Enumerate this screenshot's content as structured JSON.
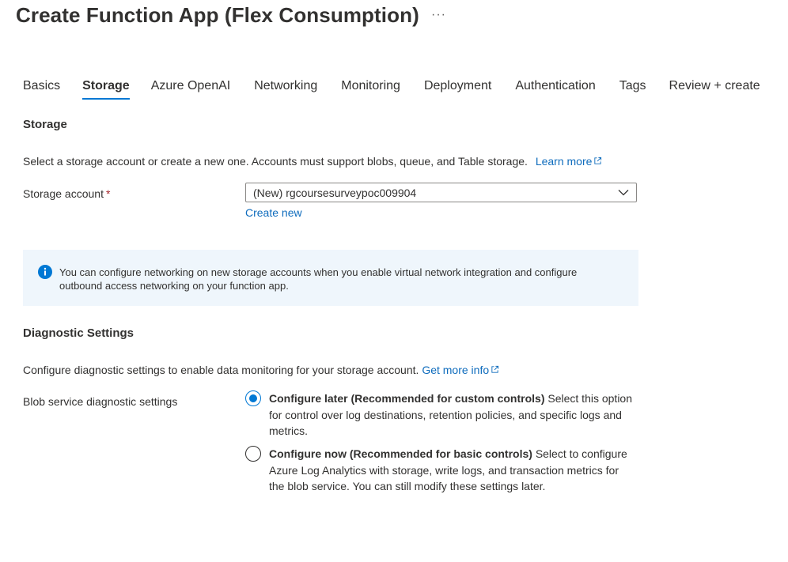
{
  "page": {
    "title": "Create Function App (Flex Consumption)",
    "more": "···"
  },
  "tabs": [
    {
      "label": "Basics"
    },
    {
      "label": "Storage",
      "active": true
    },
    {
      "label": "Azure OpenAI"
    },
    {
      "label": "Networking"
    },
    {
      "label": "Monitoring"
    },
    {
      "label": "Deployment"
    },
    {
      "label": "Authentication"
    },
    {
      "label": "Tags"
    },
    {
      "label": "Review + create"
    }
  ],
  "storage": {
    "heading": "Storage",
    "description": "Select a storage account or create a new one. Accounts must support blobs, queue, and Table storage.",
    "learn_more": "Learn more",
    "account_label": "Storage account",
    "required_mark": "*",
    "account_value": "(New) rgcoursesurveypoc009904",
    "create_new": "Create new"
  },
  "info": {
    "text": "You can configure networking on new storage accounts when you enable virtual network integration and configure outbound access networking on your function app."
  },
  "diagnostics": {
    "heading": "Diagnostic Settings",
    "description": "Configure diagnostic settings to enable data monitoring for your storage account.",
    "get_more_info": "Get more info",
    "blob_label": "Blob service diagnostic settings",
    "option_later_title": "Configure later (Recommended for custom controls)",
    "option_later_desc": "Select this option for control over log destinations, retention policies, and specific logs and metrics.",
    "option_now_title": "Configure now (Recommended for basic controls)",
    "option_now_desc": "Select to configure Azure Log Analytics with storage, write logs, and transaction metrics for the blob service. You can still modify these settings later."
  },
  "colors": {
    "accent": "#0078d4",
    "link": "#0f6cbd",
    "info_bg": "#eff6fc",
    "required": "#a4262c"
  }
}
